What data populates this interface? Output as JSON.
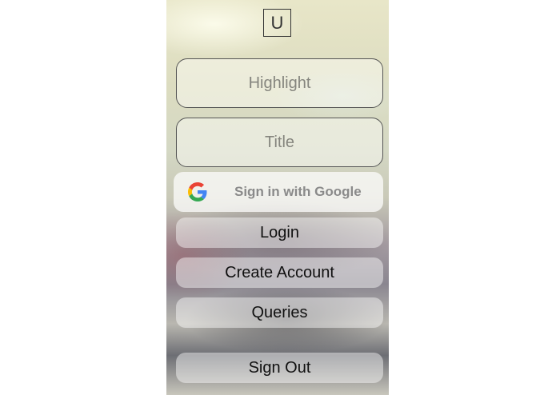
{
  "logo": {
    "letter": "U"
  },
  "fields": {
    "highlight_placeholder": "Highlight",
    "title_placeholder": "Title"
  },
  "buttons": {
    "google": "Sign in with Google",
    "login": "Login",
    "create_account": "Create Account",
    "queries": "Queries",
    "sign_out": "Sign Out"
  },
  "colors": {
    "google_blue": "#4285F4",
    "google_red": "#EA4335",
    "google_yellow": "#FBBC05",
    "google_green": "#34A853"
  }
}
